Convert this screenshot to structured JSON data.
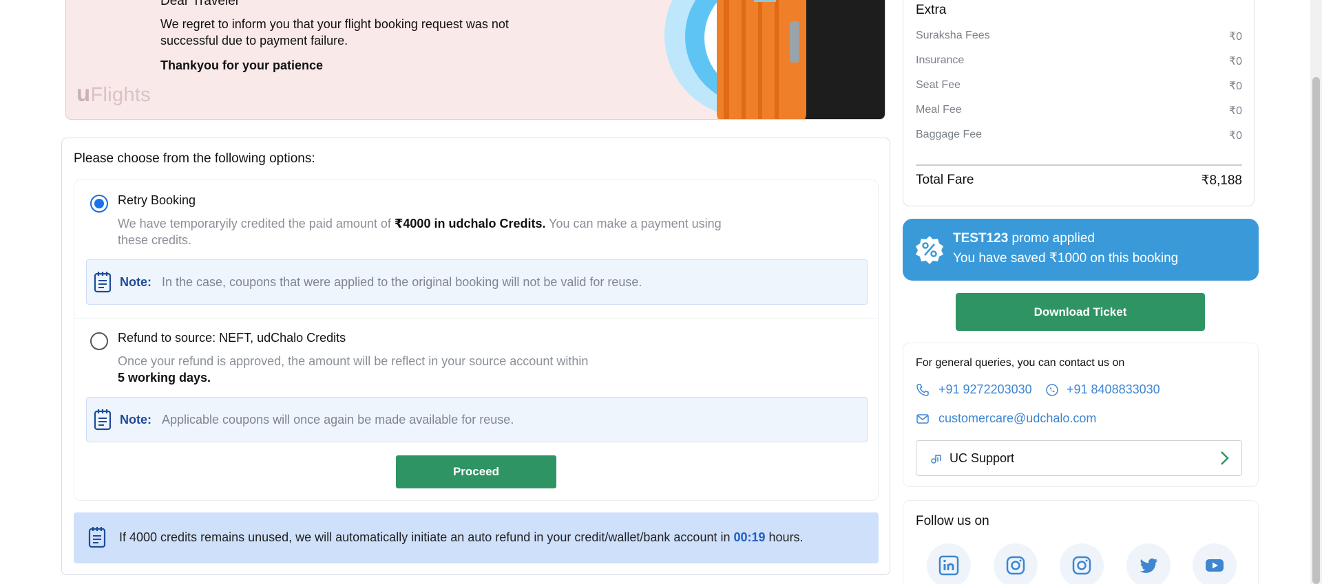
{
  "banner": {
    "greeting": "Dear Traveler",
    "message": "We regret to inform you that your flight booking request was not successful due to payment failure.",
    "thanks": "Thankyou for your patience",
    "logo_u": "u",
    "logo_text": "Flights"
  },
  "options": {
    "title": "Please choose from the following options:",
    "retry": {
      "title": "Retry Booking",
      "desc_prefix": "We have temporaryily credited the paid amount of ",
      "desc_bold": "₹4000 in udchalo Credits.",
      "desc_suffix": " You can make a payment using these credits.",
      "selected": true,
      "note_label": "Note:",
      "note_text": "In the case, coupons that were applied to the original booking will not be valid for reuse."
    },
    "refund": {
      "title": "Refund to source: NEFT, udChalo Credits",
      "desc": "Once your refund is approved, the amount will be reflect in your source account within",
      "desc_bold": "5 working days.",
      "selected": false,
      "note_label": "Note:",
      "note_text": "Applicable coupons will once again be made available for reuse."
    },
    "proceed_label": "Proceed",
    "auto_refund": {
      "prefix": "If 4000 credits remains unused, we will automatically initiate an auto refund in your credit/wallet/bank account in ",
      "timer": "00:19",
      "suffix": " hours."
    }
  },
  "fare": {
    "extra_title": "Extra",
    "rows": [
      {
        "label": "Suraksha Fees",
        "amount": "₹0"
      },
      {
        "label": "Insurance",
        "amount": "₹0"
      },
      {
        "label": "Seat Fee",
        "amount": "₹0"
      },
      {
        "label": "Meal Fee",
        "amount": "₹0"
      },
      {
        "label": "Baggage Fee",
        "amount": "₹0"
      }
    ],
    "total_label": "Total Fare",
    "total_amount": "₹8,188"
  },
  "promo": {
    "code": "TEST123",
    "applied_text": " promo applied",
    "saved_text": "You have saved ₹1000 on this booking"
  },
  "download_label": "Download Ticket",
  "contact": {
    "title": "For general queries, you can contact us on",
    "phone": "+91 9272203030",
    "whatsapp": "+91 8408833030",
    "email": "customercare@udchalo.com",
    "support_label": "UC Support"
  },
  "follow": {
    "title": "Follow us on",
    "icons": [
      "linkedin-icon",
      "instagram-icon",
      "instagram-icon",
      "twitter-icon",
      "youtube-icon"
    ]
  },
  "colors": {
    "primary_green": "#2f9464",
    "promo_blue": "#3a9ad9",
    "link_blue": "#3f86d0",
    "banner_bg": "#fae9e9"
  }
}
